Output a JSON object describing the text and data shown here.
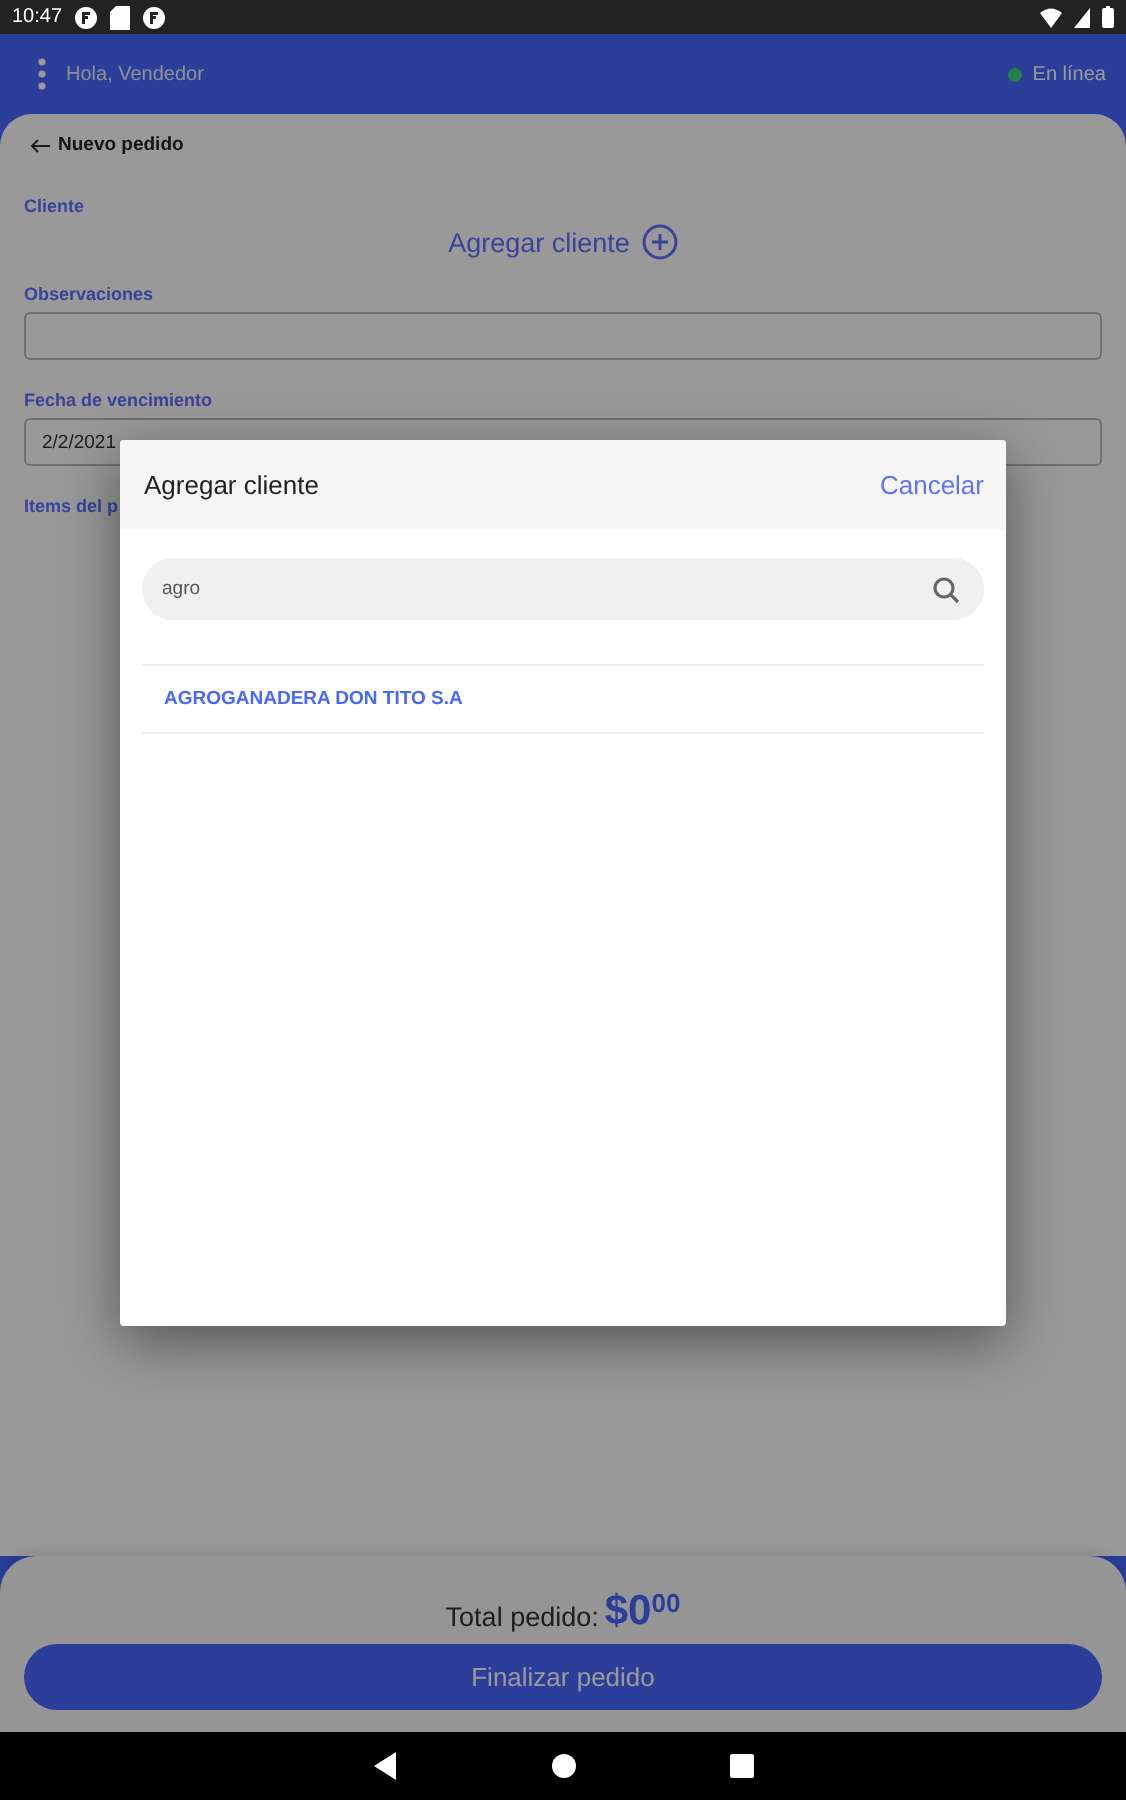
{
  "status_bar": {
    "time": "10:47"
  },
  "app_bar": {
    "greeting": "Hola, Vendedor",
    "connection": "En línea",
    "online": true
  },
  "page_title": "Nuevo pedido",
  "form": {
    "client_label": "Cliente",
    "add_client": "Agregar cliente",
    "notes_label": "Observaciones",
    "due_label": "Fecha de vencimiento",
    "due_value": "2/2/2021",
    "items_label": "Items del p"
  },
  "footer": {
    "total_label": "Total pedido:",
    "total_amount": "$0",
    "total_cents": "00",
    "finish": "Finalizar pedido"
  },
  "dialog": {
    "title": "Agregar cliente",
    "cancel": "Cancelar",
    "search": {
      "value": "agro"
    },
    "results": [
      {
        "name": "AGROGANADERA DON TITO S.A"
      }
    ]
  }
}
